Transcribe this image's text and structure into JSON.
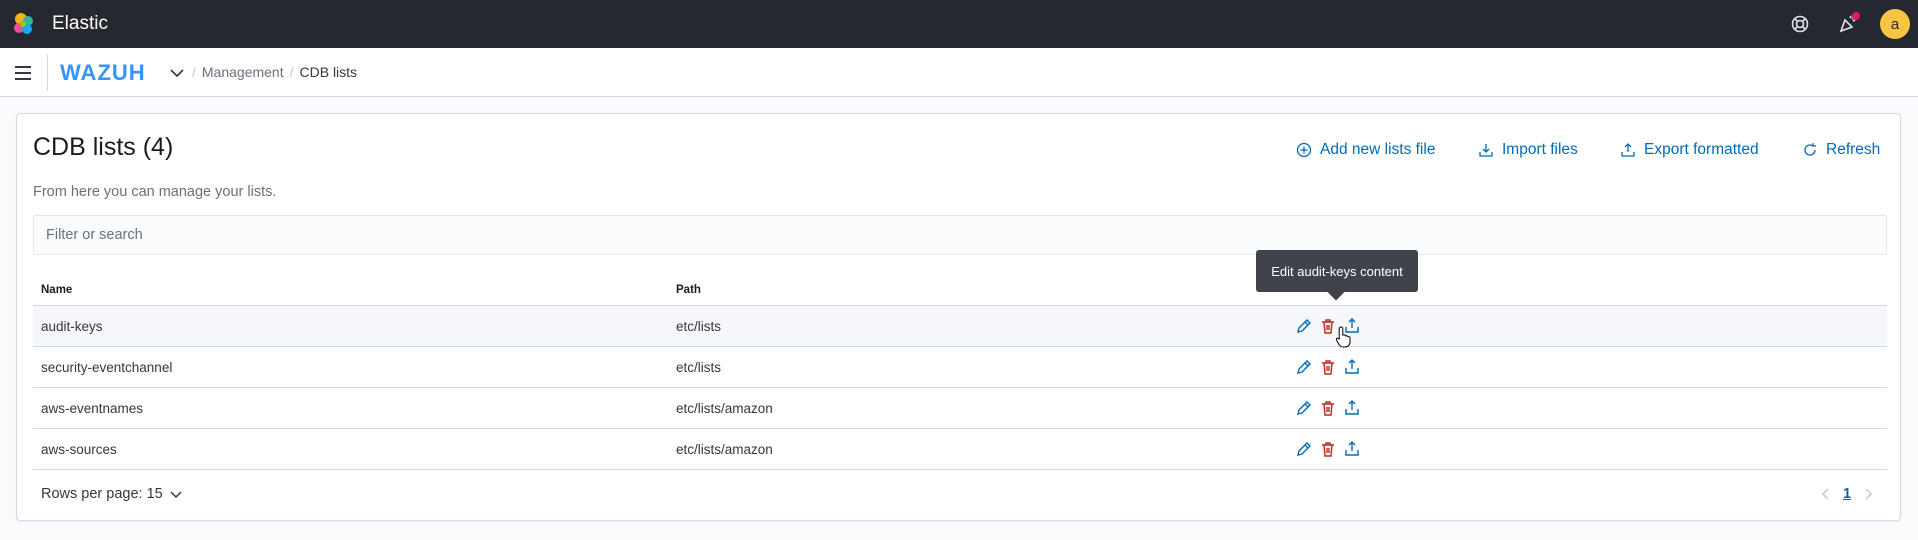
{
  "topbar": {
    "app_title": "Elastic",
    "avatar_initial": "a",
    "icons": [
      "elastic-logo",
      "help-icon",
      "newsfeed-icon"
    ]
  },
  "navbar": {
    "brand": "WAZUH",
    "breadcrumb": [
      "Management",
      "CDB lists"
    ]
  },
  "page": {
    "title": "CDB lists (4)",
    "description": "From here you can manage your lists.",
    "actions": [
      {
        "label": "Add new lists file",
        "icon": "plus-circle-icon"
      },
      {
        "label": "Import files",
        "icon": "import-icon"
      },
      {
        "label": "Export formatted",
        "icon": "export-icon"
      },
      {
        "label": "Refresh",
        "icon": "refresh-icon"
      }
    ],
    "search_placeholder": "Filter or search"
  },
  "table": {
    "columns": [
      "Name",
      "Path"
    ],
    "rows": [
      {
        "name": "audit-keys",
        "path": "etc/lists"
      },
      {
        "name": "security-eventchannel",
        "path": "etc/lists"
      },
      {
        "name": "aws-eventnames",
        "path": "etc/lists/amazon"
      },
      {
        "name": "aws-sources",
        "path": "etc/lists/amazon"
      }
    ]
  },
  "pagination": {
    "rows_per_page": "Rows per page: 15",
    "current_page": "1"
  },
  "tooltip": "Edit audit-keys content",
  "colors": {
    "topbar": "#25282f",
    "link": "#006bb8",
    "danger": "#bd271e",
    "avatar": "#f5c542"
  }
}
